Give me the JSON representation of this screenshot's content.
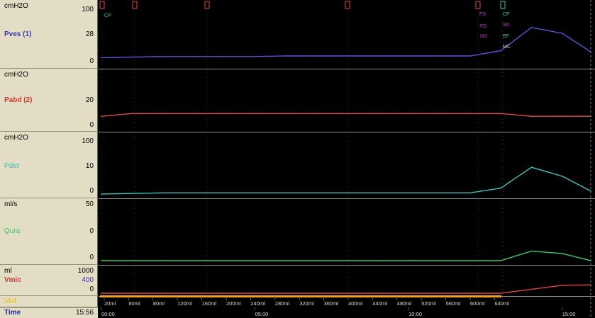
{
  "channels": [
    {
      "unit": "cmH2O",
      "name": "Pves (1)",
      "ticks": [
        "100",
        "28",
        "0"
      ],
      "color": "#5a55d6"
    },
    {
      "unit": "cmH2O",
      "name": "Pabd (2)",
      "ticks": [
        "20",
        "0"
      ],
      "color": "#e04a44"
    },
    {
      "unit": "cmH2O",
      "name": "Pdet",
      "ticks": [
        "100",
        "10",
        "0"
      ],
      "color": "#3bc6b8"
    },
    {
      "unit": "ml/s",
      "name": "Qura",
      "ticks": [
        "50",
        "0",
        "0"
      ],
      "color": "#39c76a"
    },
    {
      "unit": "ml",
      "name": "Vmic",
      "ticks": [
        "1000",
        "400",
        "0"
      ],
      "color": "#d9443c"
    }
  ],
  "infused_label": "Vinf",
  "time_label": "Time",
  "time_value": "15:56",
  "markers": [
    {
      "label": "CP",
      "color": "#3bc6b8"
    },
    {
      "label": "FS",
      "color": "#c43bc4"
    },
    {
      "label": "FD",
      "color": "#c43bc4"
    },
    {
      "label": "ND",
      "color": "#c43bc4"
    },
    {
      "label": "SD",
      "color": "#c43bc4"
    },
    {
      "label": "EF",
      "color": "#3bc6b8"
    },
    {
      "label": "CP",
      "color": "#3bc6b8"
    },
    {
      "label": "MC",
      "color": "#cccccc"
    }
  ],
  "volume_ticks": [
    "20ml",
    "60ml",
    "80ml",
    "120ml",
    "160ml",
    "200ml",
    "240ml",
    "280ml",
    "320ml",
    "360ml",
    "400ml",
    "440ml",
    "480ml",
    "520ml",
    "560ml",
    "600ml",
    "640ml"
  ],
  "time_ticks": [
    "00:00",
    "05:00",
    "10:00",
    "15:00"
  ],
  "chart_data": {
    "type": "line",
    "x": [
      0,
      1,
      2,
      3,
      4,
      5,
      6,
      7,
      8,
      9,
      10,
      11,
      12,
      13,
      14,
      15,
      15.93
    ],
    "xlabel": "Time",
    "series": [
      {
        "name": "Pves (1)",
        "ylim": [
          0,
          100
        ],
        "values": [
          8,
          9,
          10,
          10,
          10,
          10,
          11,
          11,
          11,
          11,
          11,
          11,
          11,
          20,
          60,
          50,
          18
        ]
      },
      {
        "name": "Pabd (2)",
        "ylim": [
          0,
          20
        ],
        "values": [
          4,
          5,
          5,
          5,
          5,
          5,
          5,
          5,
          5,
          5,
          5,
          5,
          5,
          5,
          4,
          4,
          4
        ]
      },
      {
        "name": "Pdet",
        "ylim": [
          0,
          100
        ],
        "values": [
          0,
          1,
          2,
          2,
          2,
          2,
          2,
          2,
          2,
          2,
          2,
          2,
          2,
          10,
          45,
          30,
          5
        ]
      },
      {
        "name": "Qura",
        "ylim": [
          0,
          50
        ],
        "values": [
          0,
          0,
          0,
          0,
          0,
          0,
          0,
          0,
          0,
          0,
          0,
          0,
          0,
          0,
          8,
          6,
          0
        ]
      },
      {
        "name": "Vmic",
        "ylim": [
          0,
          1000
        ],
        "values": [
          0,
          0,
          0,
          0,
          0,
          0,
          0,
          0,
          0,
          0,
          0,
          0,
          0,
          0,
          150,
          300,
          320
        ]
      }
    ]
  }
}
